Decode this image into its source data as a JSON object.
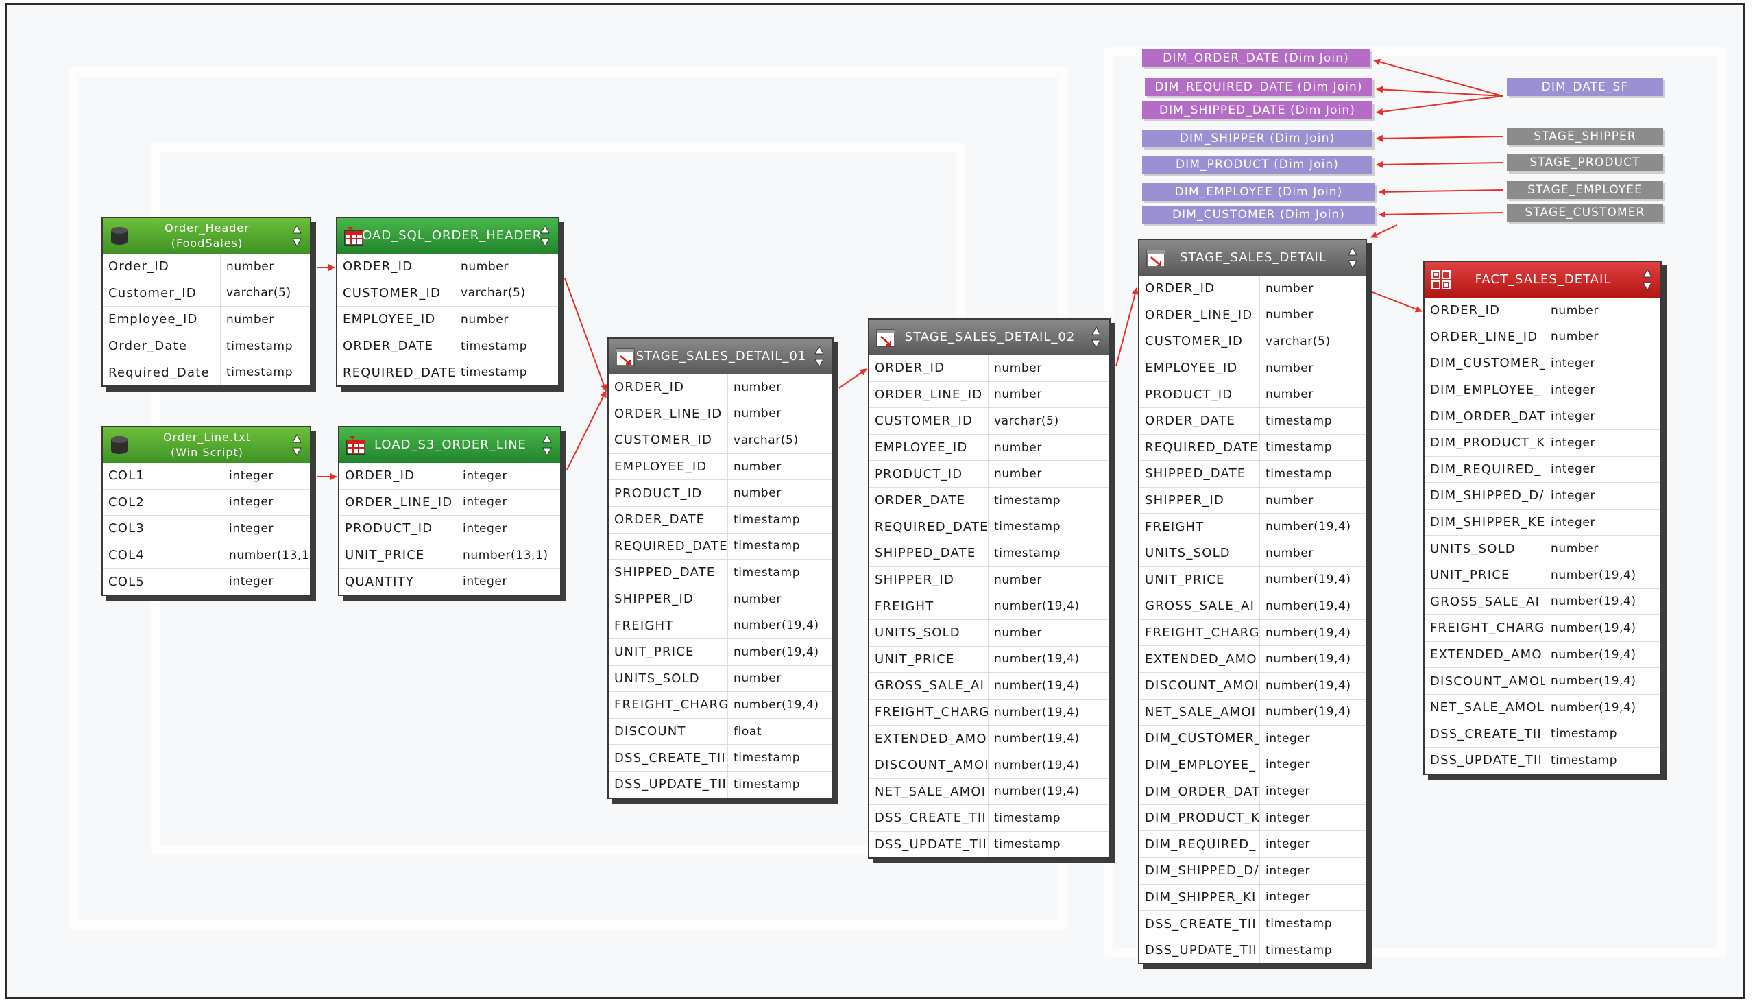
{
  "tables": {
    "order_header": {
      "title_line1": "Order_Header",
      "title_line2": "(FoodSales)",
      "rows": [
        [
          "Order_ID",
          "number"
        ],
        [
          "Customer_ID",
          "varchar(5)"
        ],
        [
          "Employee_ID",
          "number"
        ],
        [
          "Order_Date",
          "timestamp"
        ],
        [
          "Required_Date",
          "timestamp"
        ]
      ]
    },
    "order_line": {
      "title_line1": "Order_Line.txt",
      "title_line2": "(Win Script)",
      "rows": [
        [
          "COL1",
          "integer"
        ],
        [
          "COL2",
          "integer"
        ],
        [
          "COL3",
          "integer"
        ],
        [
          "COL4",
          "number(13,1"
        ],
        [
          "COL5",
          "integer"
        ]
      ]
    },
    "load_sql_order_header": {
      "title": "LOAD_SQL_ORDER_HEADER",
      "rows": [
        [
          "ORDER_ID",
          "number"
        ],
        [
          "CUSTOMER_ID",
          "varchar(5)"
        ],
        [
          "EMPLOYEE_ID",
          "number"
        ],
        [
          "ORDER_DATE",
          "timestamp"
        ],
        [
          "REQUIRED_DATE",
          "timestamp"
        ]
      ]
    },
    "load_s3_order_line": {
      "title": "LOAD_S3_ORDER_LINE",
      "rows": [
        [
          "ORDER_ID",
          "integer"
        ],
        [
          "ORDER_LINE_ID",
          "integer"
        ],
        [
          "PRODUCT_ID",
          "integer"
        ],
        [
          "UNIT_PRICE",
          "number(13,1)"
        ],
        [
          "QUANTITY",
          "integer"
        ]
      ]
    },
    "stage_sales_detail_01": {
      "title": "STAGE_SALES_DETAIL_01",
      "rows": [
        [
          "ORDER_ID",
          "number"
        ],
        [
          "ORDER_LINE_ID",
          "number"
        ],
        [
          "CUSTOMER_ID",
          "varchar(5)"
        ],
        [
          "EMPLOYEE_ID",
          "number"
        ],
        [
          "PRODUCT_ID",
          "number"
        ],
        [
          "ORDER_DATE",
          "timestamp"
        ],
        [
          "REQUIRED_DATE",
          "timestamp"
        ],
        [
          "SHIPPED_DATE",
          "timestamp"
        ],
        [
          "SHIPPER_ID",
          "number"
        ],
        [
          "FREIGHT",
          "number(19,4)"
        ],
        [
          "UNIT_PRICE",
          "number(19,4)"
        ],
        [
          "UNITS_SOLD",
          "number"
        ],
        [
          "FREIGHT_CHARG",
          "number(19,4)"
        ],
        [
          "DISCOUNT",
          "float"
        ],
        [
          "DSS_CREATE_TII",
          "timestamp"
        ],
        [
          "DSS_UPDATE_TII",
          "timestamp"
        ]
      ]
    },
    "stage_sales_detail_02": {
      "title": "STAGE_SALES_DETAIL_02",
      "rows": [
        [
          "ORDER_ID",
          "number"
        ],
        [
          "ORDER_LINE_ID",
          "number"
        ],
        [
          "CUSTOMER_ID",
          "varchar(5)"
        ],
        [
          "EMPLOYEE_ID",
          "number"
        ],
        [
          "PRODUCT_ID",
          "number"
        ],
        [
          "ORDER_DATE",
          "timestamp"
        ],
        [
          "REQUIRED_DATE",
          "timestamp"
        ],
        [
          "SHIPPED_DATE",
          "timestamp"
        ],
        [
          "SHIPPER_ID",
          "number"
        ],
        [
          "FREIGHT",
          "number(19,4)"
        ],
        [
          "UNITS_SOLD",
          "number"
        ],
        [
          "UNIT_PRICE",
          "number(19,4)"
        ],
        [
          "GROSS_SALE_AI",
          "number(19,4)"
        ],
        [
          "FREIGHT_CHARG",
          "number(19,4)"
        ],
        [
          "EXTENDED_AMO",
          "number(19,4)"
        ],
        [
          "DISCOUNT_AMOI",
          "number(19,4)"
        ],
        [
          "NET_SALE_AMOI",
          "number(19,4)"
        ],
        [
          "DSS_CREATE_TII",
          "timestamp"
        ],
        [
          "DSS_UPDATE_TII",
          "timestamp"
        ]
      ]
    },
    "stage_sales_detail": {
      "title": "STAGE_SALES_DETAIL",
      "rows": [
        [
          "ORDER_ID",
          "number"
        ],
        [
          "ORDER_LINE_ID",
          "number"
        ],
        [
          "CUSTOMER_ID",
          "varchar(5)"
        ],
        [
          "EMPLOYEE_ID",
          "number"
        ],
        [
          "PRODUCT_ID",
          "number"
        ],
        [
          "ORDER_DATE",
          "timestamp"
        ],
        [
          "REQUIRED_DATE",
          "timestamp"
        ],
        [
          "SHIPPED_DATE",
          "timestamp"
        ],
        [
          "SHIPPER_ID",
          "number"
        ],
        [
          "FREIGHT",
          "number(19,4)"
        ],
        [
          "UNITS_SOLD",
          "number"
        ],
        [
          "UNIT_PRICE",
          "number(19,4)"
        ],
        [
          "GROSS_SALE_AI",
          "number(19,4)"
        ],
        [
          "FREIGHT_CHARG",
          "number(19,4)"
        ],
        [
          "EXTENDED_AMO",
          "number(19,4)"
        ],
        [
          "DISCOUNT_AMOI",
          "number(19,4)"
        ],
        [
          "NET_SALE_AMOI",
          "number(19,4)"
        ],
        [
          "DIM_CUSTOMER_",
          "integer"
        ],
        [
          "DIM_EMPLOYEE_",
          "integer"
        ],
        [
          "DIM_ORDER_DAT",
          "integer"
        ],
        [
          "DIM_PRODUCT_K",
          "integer"
        ],
        [
          "DIM_REQUIRED_",
          "integer"
        ],
        [
          "DIM_SHIPPED_D/",
          "integer"
        ],
        [
          "DIM_SHIPPER_KI",
          "integer"
        ],
        [
          "DSS_CREATE_TII",
          "timestamp"
        ],
        [
          "DSS_UPDATE_TII",
          "timestamp"
        ]
      ]
    },
    "fact_sales_detail": {
      "title": "FACT_SALES_DETAIL",
      "rows": [
        [
          "ORDER_ID",
          "number"
        ],
        [
          "ORDER_LINE_ID",
          "number"
        ],
        [
          "DIM_CUSTOMER_",
          "integer"
        ],
        [
          "DIM_EMPLOYEE_",
          "integer"
        ],
        [
          "DIM_ORDER_DAT",
          "integer"
        ],
        [
          "DIM_PRODUCT_K",
          "integer"
        ],
        [
          "DIM_REQUIRED_",
          "integer"
        ],
        [
          "DIM_SHIPPED_D/",
          "integer"
        ],
        [
          "DIM_SHIPPER_KE",
          "integer"
        ],
        [
          "UNITS_SOLD",
          "number"
        ],
        [
          "UNIT_PRICE",
          "number(19,4)"
        ],
        [
          "GROSS_SALE_AI",
          "number(19,4)"
        ],
        [
          "FREIGHT_CHARG",
          "number(19,4)"
        ],
        [
          "EXTENDED_AMO",
          "number(19,4)"
        ],
        [
          "DISCOUNT_AMOL",
          "number(19,4)"
        ],
        [
          "NET_SALE_AMOL",
          "number(19,4)"
        ],
        [
          "DSS_CREATE_TII",
          "timestamp"
        ],
        [
          "DSS_UPDATE_TII",
          "timestamp"
        ]
      ]
    }
  },
  "dim_joins": [
    {
      "label": "DIM_ORDER_DATE (Dim Join)",
      "color": "purple"
    },
    {
      "label": "DIM_REQUIRED_DATE (Dim Join)",
      "color": "purple"
    },
    {
      "label": "DIM_SHIPPED_DATE (Dim Join)",
      "color": "purple"
    },
    {
      "label": "DIM_SHIPPER (Dim Join)",
      "color": "lilac"
    },
    {
      "label": "DIM_PRODUCT (Dim Join)",
      "color": "lilac"
    },
    {
      "label": "DIM_EMPLOYEE (Dim Join)",
      "color": "lilac"
    },
    {
      "label": "DIM_CUSTOMER (Dim Join)",
      "color": "lilac"
    }
  ],
  "sources": [
    {
      "label": "DIM_DATE_SF",
      "color": "lilac"
    },
    {
      "label": "STAGE_SHIPPER",
      "color": "gray"
    },
    {
      "label": "STAGE_PRODUCT",
      "color": "gray"
    },
    {
      "label": "STAGE_EMPLOYEE",
      "color": "gray"
    },
    {
      "label": "STAGE_CUSTOMER",
      "color": "gray"
    }
  ],
  "colors": {
    "link": "#e8302a",
    "purple": "#b56cc6",
    "lilac": "#9a90d2",
    "gray": "#8c8c8c"
  },
  "icons": {
    "source": "database-cylinder-icon",
    "load": "load-table-icon",
    "stage": "stage-table-icon",
    "fact": "fact-table-icon",
    "sort": "sort-arrows-icon"
  }
}
